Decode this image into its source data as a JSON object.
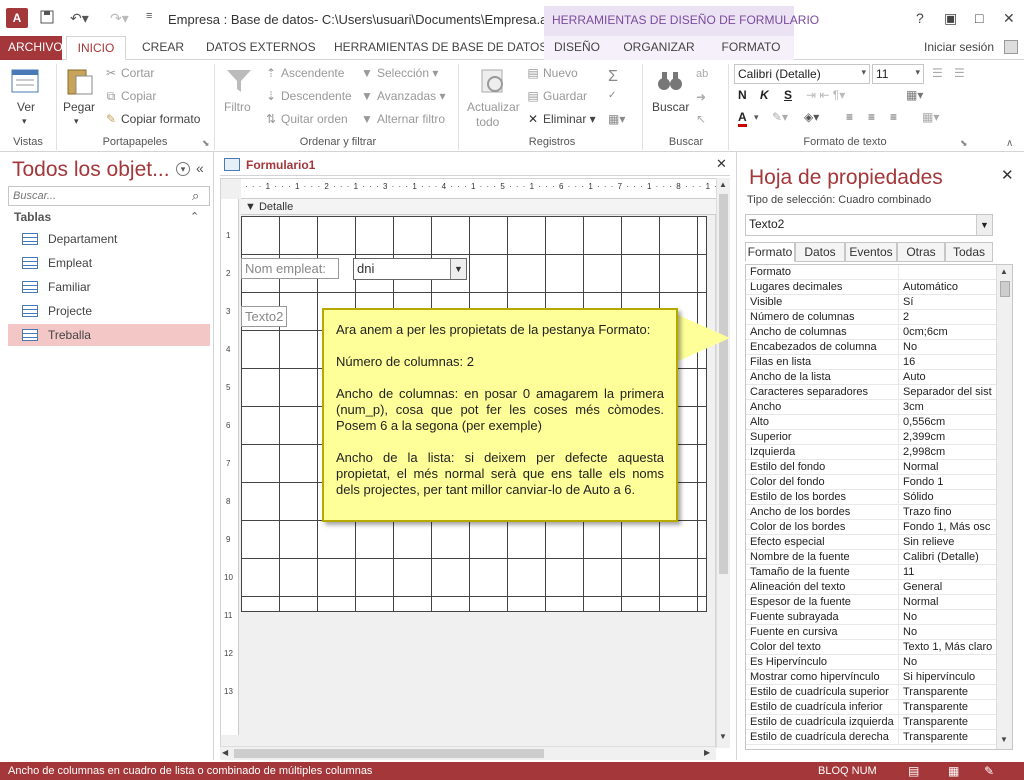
{
  "titlebar": {
    "logo": "A",
    "title": "Empresa : Base de datos- C:\\Users\\usuari\\Documents\\Empresa.acc...",
    "context_title": "HERRAMIENTAS DE DISEÑO DE FORMULARIO",
    "help": "?"
  },
  "tabs": {
    "file": "ARCHIVO",
    "items": [
      "INICIO",
      "CREAR",
      "DATOS EXTERNOS",
      "HERRAMIENTAS DE BASE DE DATOS"
    ],
    "context_items": [
      "DISEÑO",
      "ORGANIZAR",
      "FORMATO"
    ],
    "signin": "Iniciar sesión"
  },
  "ribbon": {
    "views": {
      "ver": "Ver",
      "group": "Vistas"
    },
    "clipboard": {
      "paste": "Pegar",
      "cut": "Cortar",
      "copy": "Copiar",
      "format_painter": "Copiar formato",
      "group": "Portapapeles"
    },
    "sort_filter": {
      "filter": "Filtro",
      "asc": "Ascendente",
      "desc": "Descendente",
      "remove_sort": "Quitar orden",
      "selection": "Selección",
      "advanced": "Avanzadas",
      "toggle": "Alternar filtro",
      "group": "Ordenar y filtrar"
    },
    "records": {
      "refresh": "Actualizar",
      "refresh2": "todo",
      "new": "Nuevo",
      "save": "Guardar",
      "delete": "Eliminar",
      "group": "Registros"
    },
    "find": {
      "find": "Buscar",
      "group": "Buscar"
    },
    "text_format": {
      "font": "Calibri (Detalle)",
      "size": "11",
      "bold": "N",
      "italic": "K",
      "underline": "S",
      "group": "Formato de texto"
    }
  },
  "nav": {
    "title": "Todos los objet...",
    "search_placeholder": "Buscar...",
    "section": "Tablas",
    "items": [
      {
        "label": "Departament"
      },
      {
        "label": "Empleat"
      },
      {
        "label": "Familiar"
      },
      {
        "label": "Projecte"
      },
      {
        "label": "Treballa"
      }
    ]
  },
  "document": {
    "tab": "Formulario1",
    "ruler": "· · · 1 · · · 1 · · · 2 · · · 1 · · · 3 · · · 1 · · · 4 · · · 1 · · · 5 · · · 1 · · · 6 · · · 1 · · · 7 · · · 1 · · · 8 · · · 1 · · · 9 · · · 1 · · · 10 · · · 1 · · · 11 · · · 1 · · ·",
    "vruler": [
      "1",
      "2",
      "3",
      "4",
      "5",
      "6",
      "7",
      "8",
      "9",
      "10",
      "11",
      "12",
      "13"
    ],
    "section": "Detalle",
    "label_nom": "Nom empleat:",
    "combo_value": "dni",
    "label_texto2": "Texto2"
  },
  "callout": {
    "p1": "Ara anem a per les propietats de la pestanya Formato:",
    "p2": "Número de columnas: 2",
    "p3": "Ancho de columnas: en posar 0 amagarem la primera (num_p), cosa que pot fer les coses més còmodes. Posem 6 a la segona (per exemple)",
    "p4": "Ancho de la lista: si deixem per defecte aquesta propietat, el més normal serà que ens talle els noms dels projectes, per tant millor canviar-lo de Auto a 6."
  },
  "properties": {
    "title": "Hoja de propiedades",
    "selection_label": "Tipo de selección:  Cuadro combinado",
    "selected": "Texto2",
    "tabs": [
      "Formato",
      "Datos",
      "Eventos",
      "Otras",
      "Todas"
    ],
    "rows": [
      [
        "Formato",
        ""
      ],
      [
        "Lugares decimales",
        "Automático"
      ],
      [
        "Visible",
        "Sí"
      ],
      [
        "Número de columnas",
        "2"
      ],
      [
        "Ancho de columnas",
        "0cm;6cm"
      ],
      [
        "Encabezados de columna",
        "No"
      ],
      [
        "Filas en lista",
        "16"
      ],
      [
        "Ancho de la lista",
        "Auto"
      ],
      [
        "Caracteres separadores",
        "Separador del sist"
      ],
      [
        "Ancho",
        "3cm"
      ],
      [
        "Alto",
        "0,556cm"
      ],
      [
        "Superior",
        "2,399cm"
      ],
      [
        "Izquierda",
        "2,998cm"
      ],
      [
        "Estilo del fondo",
        "Normal"
      ],
      [
        "Color del fondo",
        "Fondo 1"
      ],
      [
        "Estilo de los bordes",
        "Sólido"
      ],
      [
        "Ancho de los bordes",
        "Trazo fino"
      ],
      [
        "Color de los bordes",
        "Fondo 1, Más osc"
      ],
      [
        "Efecto especial",
        "Sin relieve"
      ],
      [
        "Nombre de la fuente",
        "Calibri (Detalle)"
      ],
      [
        "Tamaño de la fuente",
        "11"
      ],
      [
        "Alineación del texto",
        "General"
      ],
      [
        "Espesor de la fuente",
        "Normal"
      ],
      [
        "Fuente subrayada",
        "No"
      ],
      [
        "Fuente en cursiva",
        "No"
      ],
      [
        "Color del texto",
        "Texto 1, Más claro"
      ],
      [
        "Es Hipervínculo",
        "No"
      ],
      [
        "Mostrar como hipervínculo",
        "Si hipervínculo"
      ],
      [
        "Estilo de cuadrícula superior",
        "Transparente"
      ],
      [
        "Estilo de cuadrícula inferior",
        "Transparente"
      ],
      [
        "Estilo de cuadrícula izquierda",
        "Transparente"
      ],
      [
        "Estilo de cuadrícula derecha",
        "Transparente"
      ]
    ]
  },
  "status": {
    "message": "Ancho de columnas en cuadro de lista o combinado de múltiples columnas",
    "mode": "BLOQ NUM"
  },
  "colors": {
    "accent": "#a4373a",
    "context": "#7b4a9c",
    "callout": "#ffff99"
  }
}
